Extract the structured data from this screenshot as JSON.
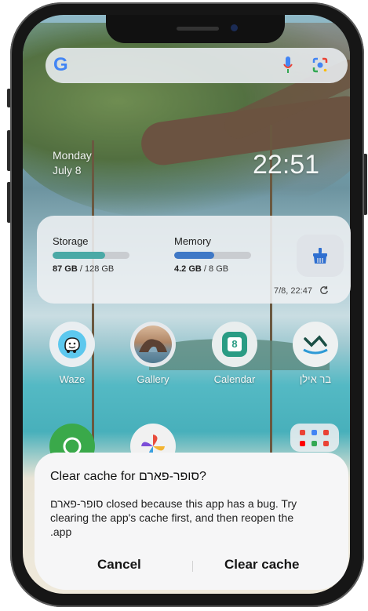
{
  "search": {
    "logo": "G",
    "icons": [
      "google-g-icon",
      "mic-icon",
      "lens-icon"
    ]
  },
  "lockscreen": {
    "day": "Monday",
    "date": "July 8",
    "time": "22:51"
  },
  "widget": {
    "storage_label": "Storage",
    "storage_used": "87 GB",
    "storage_total": "/ 128 GB",
    "storage_fraction": 0.68,
    "memory_label": "Memory",
    "memory_used": "4.2 GB",
    "memory_total": "/ 8 GB",
    "memory_fraction": 0.52,
    "timestamp": "7/8, 22:47",
    "storage_color": "#4aa9a6",
    "memory_color": "#3f78c6"
  },
  "apps": [
    {
      "label": "Waze",
      "icon": "waze-icon"
    },
    {
      "label": "Gallery",
      "icon": "gallery-icon"
    },
    {
      "label": "Calendar",
      "icon": "calendar-icon",
      "badge": "8"
    },
    {
      "label": "בר אילן",
      "icon": "bar-ilan-icon"
    }
  ],
  "dialog": {
    "title": "Clear cache for סופר-פארם?",
    "body_line1": "סופר-פארם closed because this app has a bug. Try",
    "body_line2": "clearing the app's cache first, and then reopen the",
    "body_line3": ".app",
    "cancel_label": "Cancel",
    "confirm_label": "Clear cache"
  }
}
